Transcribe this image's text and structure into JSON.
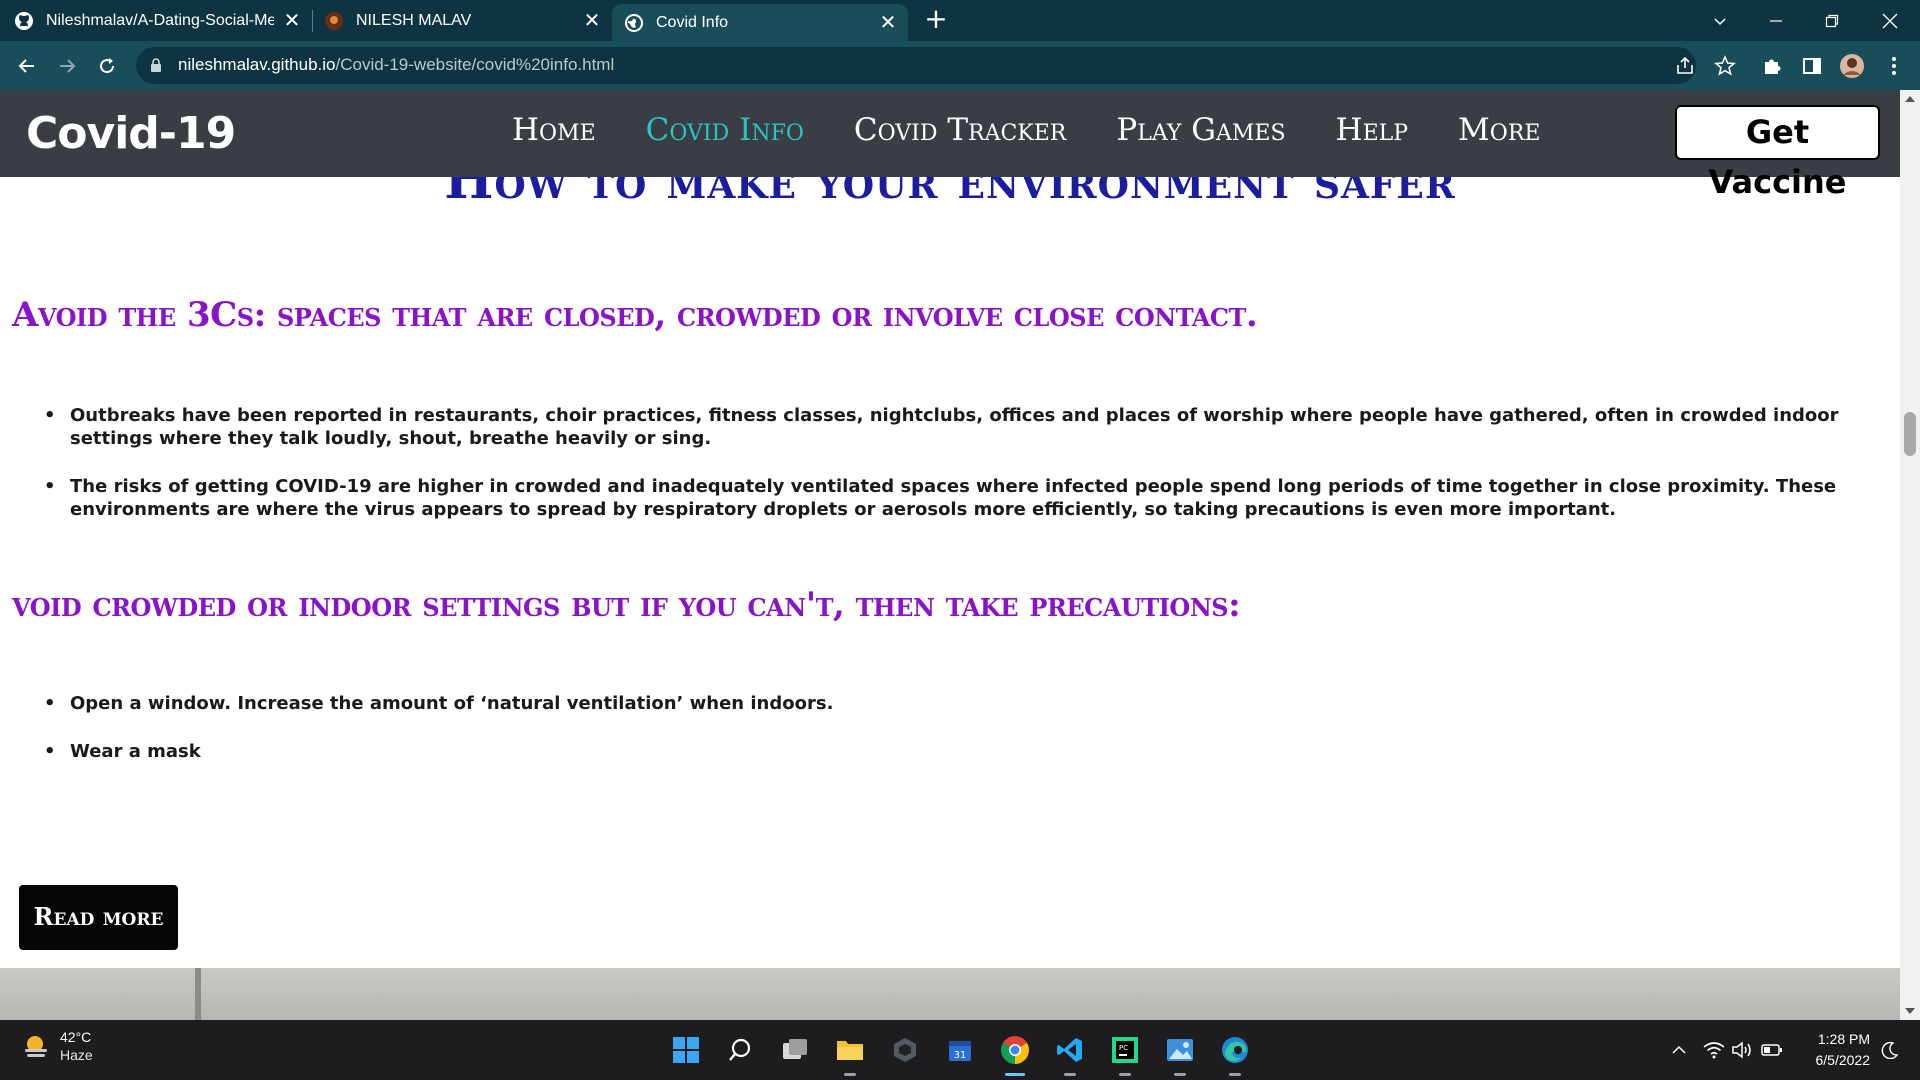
{
  "browser": {
    "tabs": [
      {
        "title": "Nileshmalav/A-Dating-Social-Me",
        "icon": "github-icon"
      },
      {
        "title": "NILESH MALAV",
        "icon": "avatar-favicon"
      },
      {
        "title": "Covid Info",
        "icon": "globe-icon",
        "active": true
      }
    ],
    "url_host": "nileshmalav.github.io",
    "url_path": "/Covid-19-website/covid%20info.html"
  },
  "site": {
    "logo": "Covid-19",
    "nav": [
      "Home",
      "Covid Info",
      "Covid Tracker",
      "Play Games",
      "Help",
      "More"
    ],
    "active_nav": "Covid Info",
    "cta": "Get Vaccine"
  },
  "content": {
    "page_heading": "How to make your environment safer",
    "section1": {
      "heading": "Avoid the 3Cs: spaces that are closed, crowded or involve close contact.",
      "bullets": [
        "Outbreaks have been reported in restaurants, choir practices, fitness classes, nightclubs, offices and places of worship where people have gathered, often in crowded indoor settings where they talk loudly, shout, breathe heavily or sing.",
        "The risks of getting COVID-19 are higher in crowded and inadequately ventilated spaces where infected people spend long periods of time together in close proximity. These environments are where the virus appears to spread by respiratory droplets or aerosols more efficiently, so taking precautions is even more important."
      ]
    },
    "section2": {
      "heading": "void crowded or indoor settings but if you can't, then take precautions:",
      "bullets": [
        "Open a window. Increase the amount of ‘natural ventilation’ when indoors.",
        "Wear a mask"
      ]
    },
    "read_more": "Read more"
  },
  "taskbar": {
    "weather_temp": "42°C",
    "weather_cond": "Haze",
    "time": "1:28 PM",
    "date": "6/5/2022"
  },
  "colors": {
    "tab_bar": "#0d3440",
    "address_bar": "#1a4d5a",
    "site_nav": "#3a3d44",
    "nav_active": "#29c4c4",
    "section_heading": "#8a12c8",
    "page_heading": "#1c1c9e"
  }
}
